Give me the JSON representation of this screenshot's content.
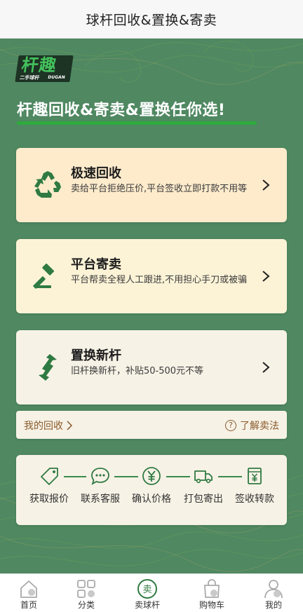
{
  "header": {
    "title": "球杆回收&置换&寄卖"
  },
  "brand": {
    "logo_text": "杆趣",
    "logo_sub_left": "二手球杆",
    "logo_sub_right": "DUGAN"
  },
  "banner": {
    "slogan": "杆趣回收&寄卖&置换任你选!"
  },
  "services": [
    {
      "name": "极速回收",
      "desc": "卖给平台拒绝压价,平台签收立即打款不用等",
      "icon": "recycle-icon"
    },
    {
      "name": "平台寄卖",
      "desc": "平台帮卖全程人工跟进,不用担心手刀或被骗",
      "icon": "gavel-icon"
    },
    {
      "name": "置换新杆",
      "desc": "旧杆换新杆，补贴50-500元不等",
      "icon": "exchange-arrows-icon"
    }
  ],
  "links": {
    "my_recycle": "我的回收",
    "learn_sell": "了解卖法"
  },
  "steps": [
    {
      "label": "获取报价",
      "icon": "tag-icon"
    },
    {
      "label": "联系客服",
      "icon": "chat-icon"
    },
    {
      "label": "确认价格",
      "icon": "yen-icon"
    },
    {
      "label": "打包寄出",
      "icon": "truck-icon"
    },
    {
      "label": "签收转款",
      "icon": "receipt-icon"
    }
  ],
  "tabs": [
    {
      "label": "首页",
      "icon": "home-icon",
      "active": false
    },
    {
      "label": "分类",
      "icon": "grid-icon",
      "active": false
    },
    {
      "label": "卖球杆",
      "icon": "sell-icon",
      "icon_char": "卖",
      "active": true
    },
    {
      "label": "购物车",
      "icon": "cart-icon",
      "active": false
    },
    {
      "label": "我的",
      "icon": "user-icon",
      "active": false
    }
  ],
  "colors": {
    "background_green": "#4f8861",
    "accent_green": "#2eaa3e",
    "icon_green": "#2f7a42",
    "link_brown": "#8a5a2c"
  }
}
